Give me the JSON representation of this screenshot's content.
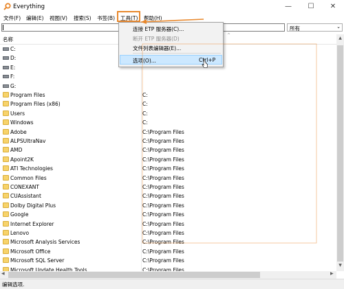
{
  "window": {
    "title": "Everything",
    "minimize_glyph": "—",
    "maximize_glyph": "☐",
    "close_glyph": "✕"
  },
  "menubar": {
    "file": "文件(F)",
    "edit": "编辑(E)",
    "view": "视图(V)",
    "search": "搜索(S)",
    "bookmarks": "书签(B)",
    "tools": "工具(T)",
    "help": "帮助(H)"
  },
  "search": {
    "value": "",
    "filter": "所有"
  },
  "columns": {
    "name": "名称"
  },
  "rows": [
    {
      "name": "C:",
      "path": "",
      "icon": "drive-icon"
    },
    {
      "name": "D:",
      "path": "",
      "icon": "drive-icon"
    },
    {
      "name": "E:",
      "path": "",
      "icon": "drive-icon"
    },
    {
      "name": "F:",
      "path": "",
      "icon": "drive-icon"
    },
    {
      "name": "G:",
      "path": "",
      "icon": "drive-icon"
    },
    {
      "name": "Program Files",
      "path": "C:",
      "icon": "folder-icon"
    },
    {
      "name": "Program Files (x86)",
      "path": "C:",
      "icon": "folder-icon"
    },
    {
      "name": "Users",
      "path": "C:",
      "icon": "folder-icon"
    },
    {
      "name": "Windows",
      "path": "C:",
      "icon": "folder-icon"
    },
    {
      "name": "Adobe",
      "path": "C:\\Program Files",
      "icon": "folder-icon"
    },
    {
      "name": "ALPSUltraNav",
      "path": "C:\\Program Files",
      "icon": "folder-icon"
    },
    {
      "name": "AMD",
      "path": "C:\\Program Files",
      "icon": "folder-icon"
    },
    {
      "name": "Apoint2K",
      "path": "C:\\Program Files",
      "icon": "folder-icon"
    },
    {
      "name": "ATI Technologies",
      "path": "C:\\Program Files",
      "icon": "folder-icon"
    },
    {
      "name": "Common Files",
      "path": "C:\\Program Files",
      "icon": "folder-icon"
    },
    {
      "name": "CONEXANT",
      "path": "C:\\Program Files",
      "icon": "folder-icon"
    },
    {
      "name": "CUAssistant",
      "path": "C:\\Program Files",
      "icon": "folder-icon"
    },
    {
      "name": "Dolby Digital Plus",
      "path": "C:\\Program Files",
      "icon": "folder-icon"
    },
    {
      "name": "Google",
      "path": "C:\\Program Files",
      "icon": "folder-icon"
    },
    {
      "name": "Internet Explorer",
      "path": "C:\\Program Files",
      "icon": "folder-icon"
    },
    {
      "name": "Lenovo",
      "path": "C:\\Program Files",
      "icon": "folder-icon"
    },
    {
      "name": "Microsoft Analysis Services",
      "path": "C:\\Program Files",
      "icon": "folder-icon"
    },
    {
      "name": "Microsoft Office",
      "path": "C:\\Program Files",
      "icon": "folder-icon"
    },
    {
      "name": "Microsoft SQL Server",
      "path": "C:\\Program Files",
      "icon": "folder-icon"
    },
    {
      "name": "Microsoft Update Health Tools",
      "path": "C:\\Program Files",
      "icon": "folder-icon"
    }
  ],
  "tools_menu": {
    "connect_etp": "连接 ETP 服务器(C)...",
    "disconnect_etp": "断开 ETP 服务器(D)",
    "filelist_editor": "文件列表编辑器(E)...",
    "options": "选项(O)...",
    "options_shortcut": "Ctrl+P"
  },
  "status": {
    "text": "编辑选项."
  },
  "colors": {
    "annotation": "#e8872b",
    "highlight": "#cce8ff",
    "folder": "#f7d36b"
  }
}
